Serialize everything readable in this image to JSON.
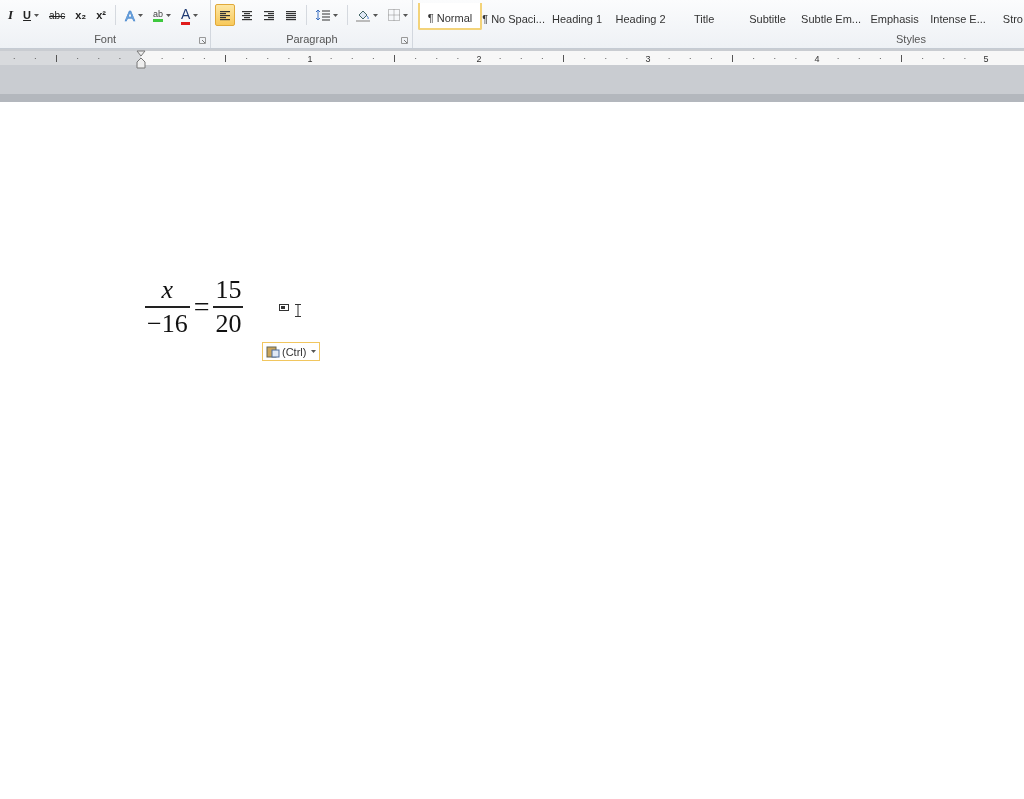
{
  "ribbon": {
    "font_group": {
      "label": "Font",
      "buttons": [
        {
          "text": "I",
          "kind": "italic",
          "caret": false
        },
        {
          "text": "U",
          "kind": "underline",
          "caret": true
        },
        {
          "text": "abc",
          "kind": "strike",
          "caret": false
        },
        {
          "text": "x₂",
          "kind": "plain",
          "caret": false
        },
        {
          "text": "x²",
          "kind": "plain",
          "caret": false
        },
        {
          "text": "A",
          "kind": "effects",
          "caret": true
        },
        {
          "text": "ab",
          "kind": "highlight",
          "caret": true
        },
        {
          "text": "A",
          "kind": "fontcolor",
          "caret": true
        }
      ]
    },
    "paragraph_group": {
      "label": "Paragraph",
      "alignment": [
        {
          "selected": true
        },
        {
          "selected": false
        },
        {
          "selected": false
        },
        {
          "selected": false
        }
      ]
    },
    "styles_group": {
      "label": "Styles",
      "items": [
        {
          "label": "¶ Normal",
          "selected": true
        },
        {
          "label": "¶ No Spaci...",
          "selected": false
        },
        {
          "label": "Heading 1",
          "selected": false
        },
        {
          "label": "Heading 2",
          "selected": false
        },
        {
          "label": "Title",
          "selected": false
        },
        {
          "label": "Subtitle",
          "selected": false
        },
        {
          "label": "Subtle Em...",
          "selected": false
        },
        {
          "label": "Emphasis",
          "selected": false
        },
        {
          "label": "Intense E...",
          "selected": false
        },
        {
          "label": "Stro",
          "selected": false
        }
      ]
    }
  },
  "ruler": {
    "numbers": [
      "1",
      "2",
      "3",
      "4",
      "5"
    ]
  },
  "document": {
    "equation": {
      "left_numerator": "x",
      "left_denominator": "−16",
      "operator": "=",
      "right_numerator": "15",
      "right_denominator": "20"
    },
    "paste_options": {
      "label": "(Ctrl)"
    }
  }
}
